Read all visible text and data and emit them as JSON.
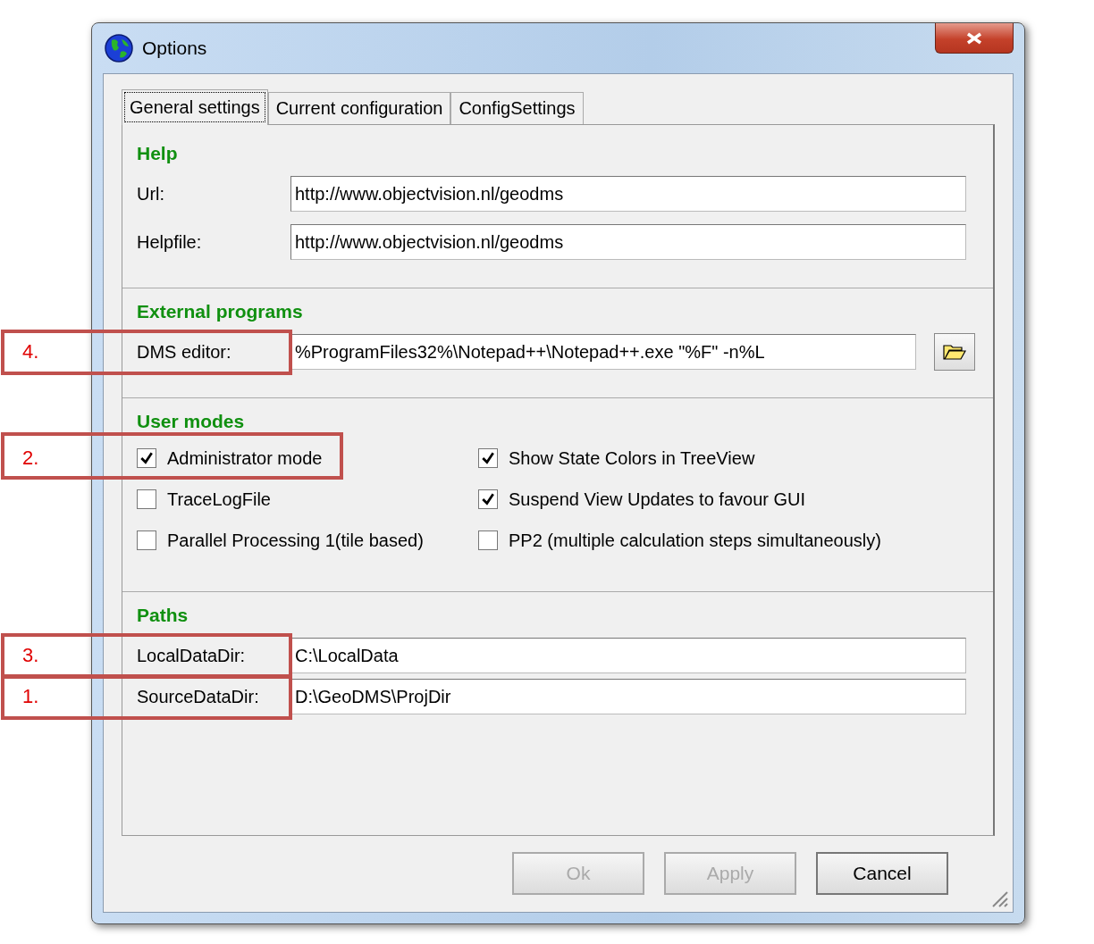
{
  "window": {
    "title": "Options"
  },
  "tabs": [
    {
      "label": "General settings",
      "selected": true
    },
    {
      "label": "Current configuration",
      "selected": false
    },
    {
      "label": "ConfigSettings",
      "selected": false
    }
  ],
  "sections": [
    {
      "heading": "Help",
      "kind": "fields",
      "items": [
        {
          "label": "Url:",
          "value": "http://www.objectvision.nl/geodms"
        },
        {
          "label": "Helpfile:",
          "value": "http://www.objectvision.nl/geodms"
        }
      ]
    },
    {
      "heading": "External programs",
      "kind": "fields",
      "items": [
        {
          "label": "DMS editor:",
          "value": "%ProgramFiles32%\\Notepad++\\Notepad++.exe \"%F\" -n%L",
          "browse": true,
          "callout": "4."
        }
      ]
    },
    {
      "heading": "User modes",
      "kind": "checks",
      "items": [
        {
          "label": "Administrator mode",
          "checked": true,
          "callout": "2."
        },
        {
          "label": "Show State Colors in TreeView",
          "checked": true
        },
        {
          "label": "TraceLogFile",
          "checked": false
        },
        {
          "label": "Suspend View Updates to favour GUI",
          "checked": true
        },
        {
          "label": "Parallel Processing 1(tile based)",
          "checked": false
        },
        {
          "label": "PP2 (multiple calculation steps simultaneously)",
          "checked": false
        }
      ]
    },
    {
      "heading": "Paths",
      "kind": "fields",
      "items": [
        {
          "label": "LocalDataDir:",
          "value": "C:\\LocalData",
          "callout": "3."
        },
        {
          "label": "SourceDataDir:",
          "value": "D:\\GeoDMS\\ProjDir",
          "callout": "1."
        }
      ]
    }
  ],
  "buttons": [
    {
      "label": "Ok",
      "disabled": true
    },
    {
      "label": "Apply",
      "disabled": true
    },
    {
      "label": "Cancel",
      "disabled": false
    }
  ]
}
